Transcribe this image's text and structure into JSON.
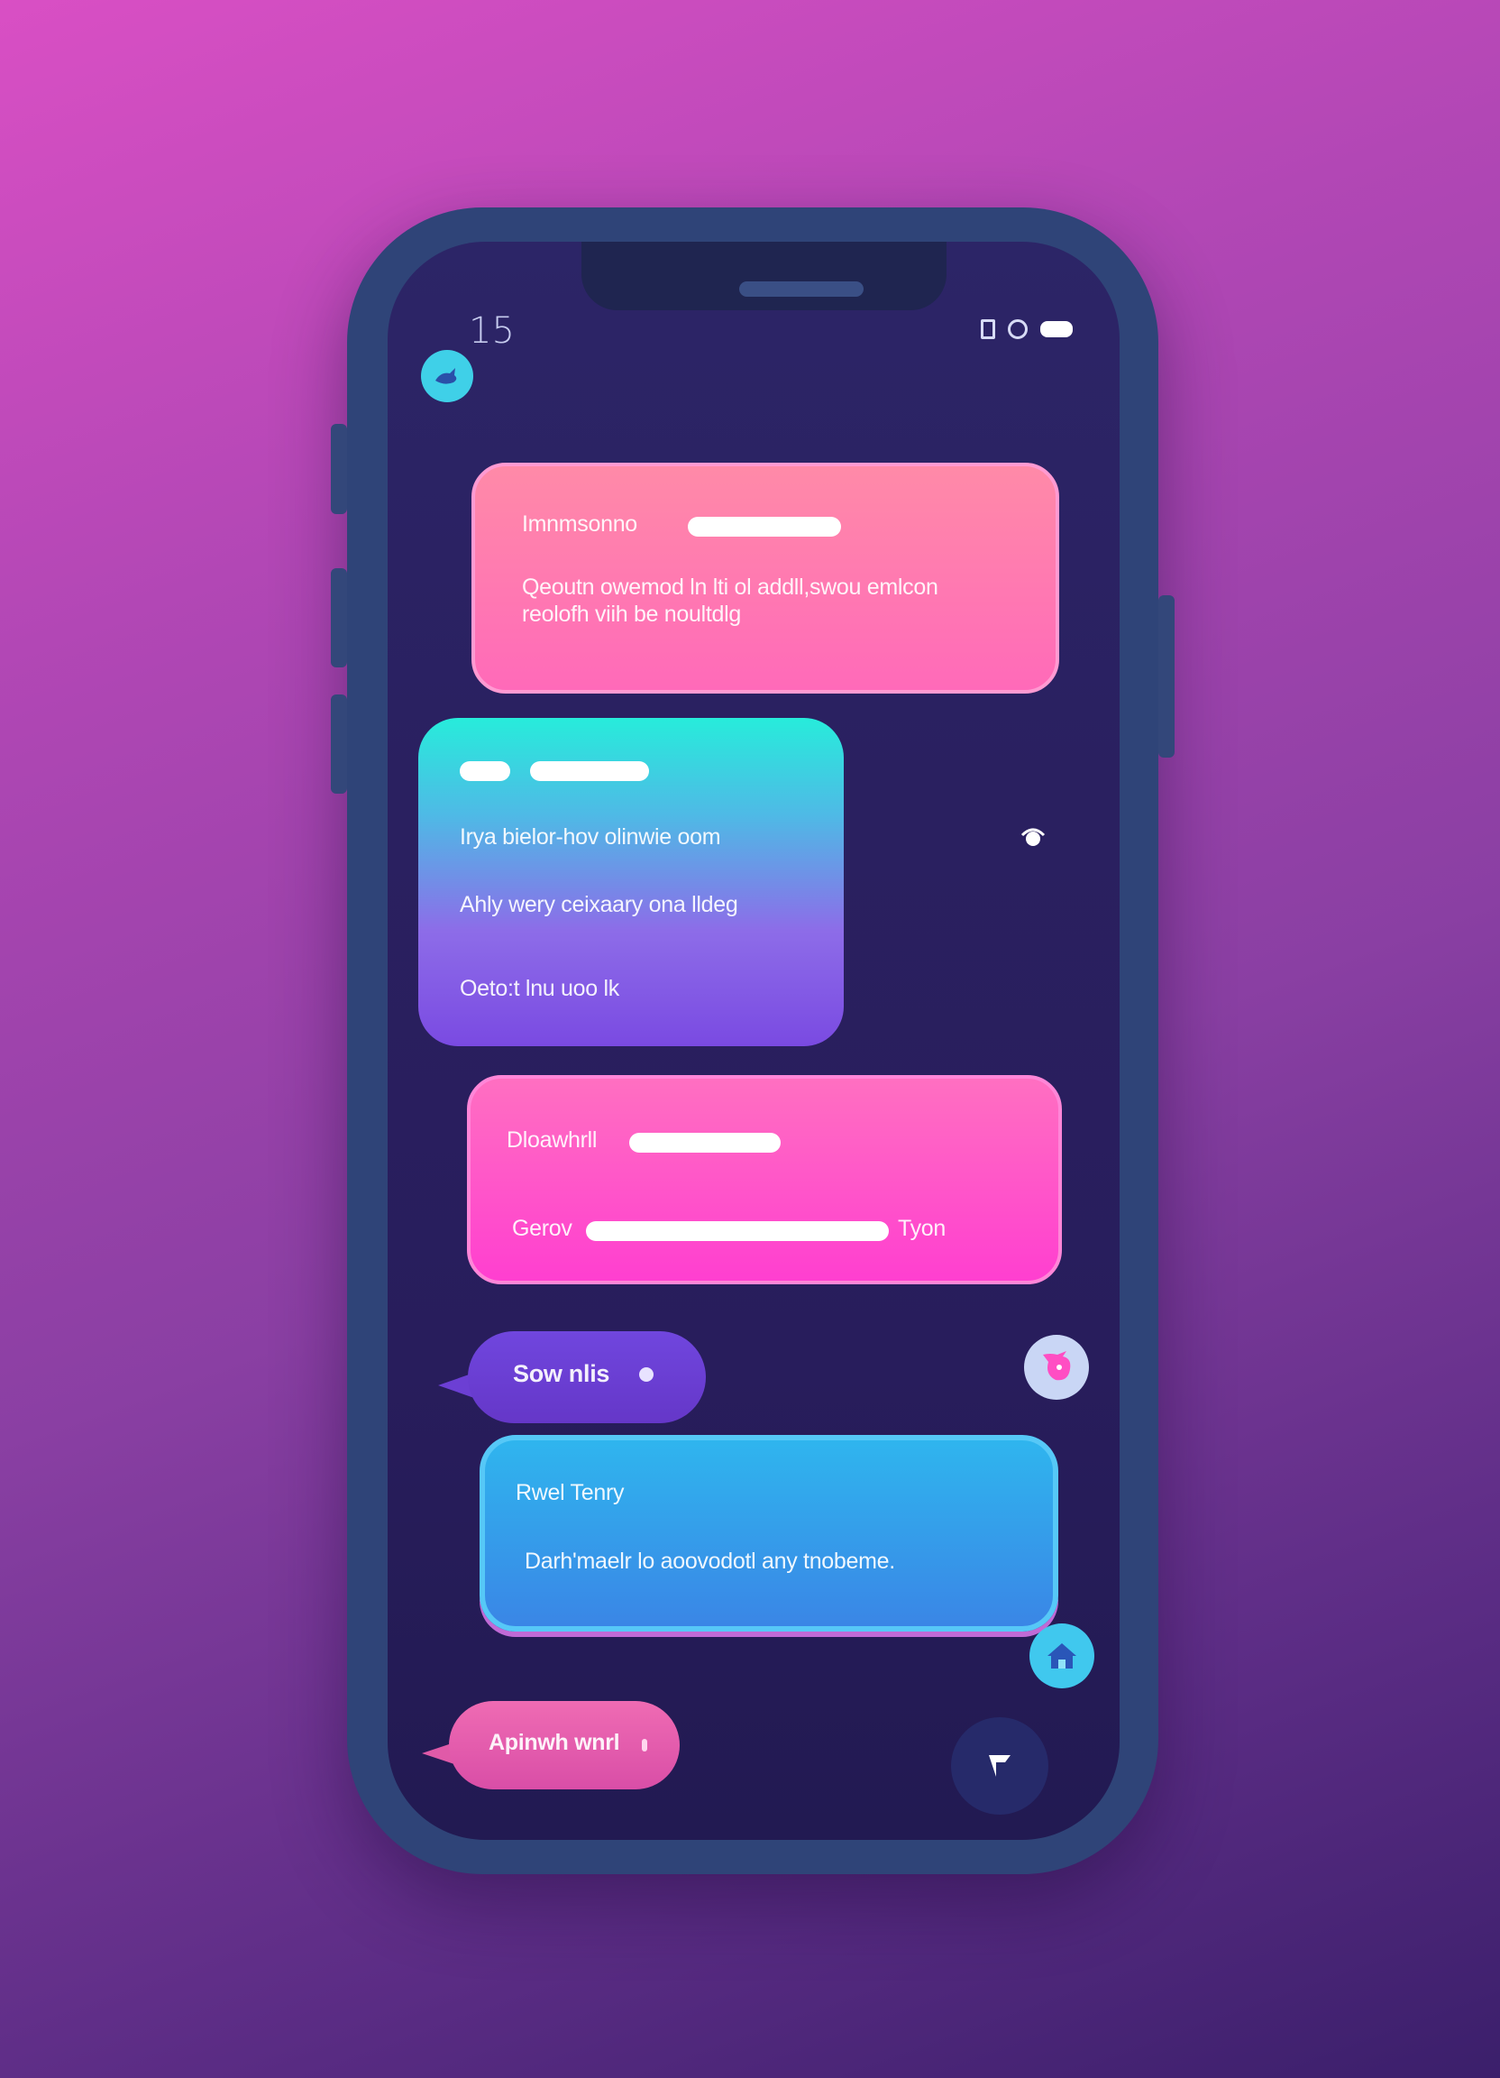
{
  "status_bar": {
    "time": "15"
  },
  "colors": {
    "background_top": "#d94fc4",
    "background_bottom": "#3b1f6b",
    "phone_frame": "#2f4478",
    "screen": "#2a2060",
    "pink_bubble": "#ff6fb0",
    "teal_bubble": "#27e6dc",
    "violet_bubble": "#7b4fe8",
    "blue_bubble": "#3a8be8",
    "send_button": "#262a6a"
  },
  "messages": [
    {
      "id": "msg-1",
      "title": "Imnmsonno",
      "body_line1": "Qeoutn owemod ln lti ol addll,swou emlcon",
      "body_line2": "reolofh viih be noultdlg"
    },
    {
      "id": "msg-2",
      "line1": "Irya bielor-hov olinwie oom",
      "line2": "Ahly wery ceixaary ona lldeg",
      "line3": "Oeto:t lnu uoo lk"
    },
    {
      "id": "msg-3",
      "title": "Dloawhrll",
      "footer_left": "Gerov",
      "footer_right": "Tyon"
    },
    {
      "id": "msg-4",
      "text": "Sow nlis"
    },
    {
      "id": "msg-5",
      "title": "Rwel Tenry",
      "body": "Darh'maelr lo aoovodotl any tnobeme."
    },
    {
      "id": "msg-6",
      "text": "Apinwh wnrl"
    }
  ],
  "icons": {
    "top_avatar": "bird-icon",
    "read_indicator": "eye-icon",
    "pink_avatar": "creature-icon",
    "blue_avatar": "house-icon",
    "send": "send-icon"
  }
}
